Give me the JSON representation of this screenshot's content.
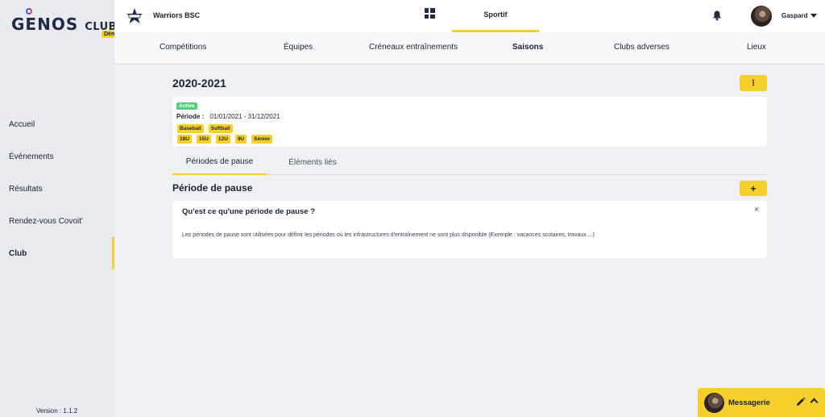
{
  "brand": {
    "name": "GENOS",
    "suffix": "CLUBS",
    "badge": "Démo"
  },
  "sidebar": {
    "items": [
      {
        "label": "Accueil"
      },
      {
        "label": "Événements"
      },
      {
        "label": "Résultats"
      },
      {
        "label": "Rendez-vous Covoit'"
      },
      {
        "label": "Club"
      }
    ],
    "active": "Club",
    "version": "Version : 1.1.2"
  },
  "topbar": {
    "club_name": "Warriors BSC",
    "active_tab": "Sportif",
    "user_name": "Gaspard",
    "icons": [
      "dashboard-icon",
      "bell-icon",
      "caret-down-icon"
    ]
  },
  "subnav": {
    "items": [
      {
        "label": "Compétitions"
      },
      {
        "label": "Équipes"
      },
      {
        "label": "Créneaux entraînements"
      },
      {
        "label": "Saisons"
      },
      {
        "label": "Clubs adverses"
      },
      {
        "label": "Lieux"
      }
    ],
    "active": "Saisons"
  },
  "season": {
    "title": "2020-2021",
    "menu_label": "⋮",
    "status": "Active",
    "period_label": "Période :",
    "period_value": "01/01/2021 - 31/12/2021",
    "sports": [
      "Baseball",
      "Softball"
    ],
    "categories": [
      "18U",
      "15U",
      "12U",
      "9U",
      "Sénior"
    ]
  },
  "tabs": [
    {
      "label": "Périodes de pause"
    },
    {
      "label": "Éléments liés"
    }
  ],
  "pause": {
    "title": "Période de pause",
    "add_label": "+",
    "info_title": "Qu'est ce qu'une période de pause ?",
    "info_close": "×",
    "info_text": "Les périodes de pause sont utilisées pour définir les périodes où les infrastructures d'entraînement ne sont plus disponible (Exemple : vacances scolaires, travaux ...)"
  },
  "messaging": {
    "label": "Messagerie"
  },
  "colors": {
    "accent": "#f5cf2a",
    "success": "#4fd17a",
    "text": "#1b2238",
    "background": "#eef0f3"
  }
}
